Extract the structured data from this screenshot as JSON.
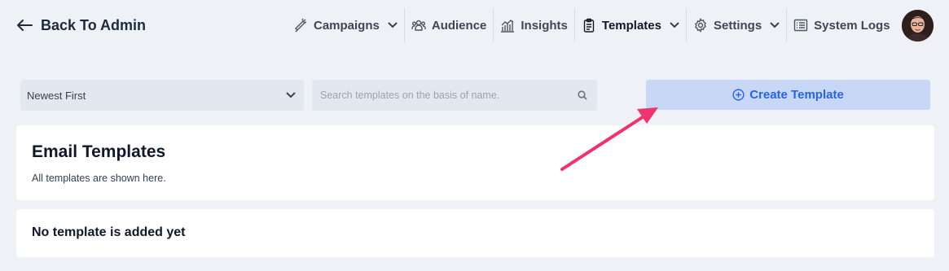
{
  "header": {
    "back_label": "Back To Admin",
    "nav": [
      {
        "label": "Campaigns",
        "icon": "megaphone-icon",
        "dropdown": true
      },
      {
        "label": "Audience",
        "icon": "users-icon",
        "dropdown": false
      },
      {
        "label": "Insights",
        "icon": "chart-icon",
        "dropdown": false
      },
      {
        "label": "Templates",
        "icon": "clipboard-icon",
        "dropdown": true,
        "active": true
      },
      {
        "label": "Settings",
        "icon": "gear-icon",
        "dropdown": true
      },
      {
        "label": "System Logs",
        "icon": "list-icon",
        "dropdown": false
      }
    ]
  },
  "toolbar": {
    "sort_value": "Newest First",
    "search_placeholder": "Search templates on the basis of name.",
    "create_label": "Create Template"
  },
  "main": {
    "title": "Email Templates",
    "subtitle": "All templates are shown here.",
    "empty_message": "No template is added yet"
  },
  "colors": {
    "background": "#eef2f7",
    "accent": "#2563eb",
    "button_bg": "#c7d7f5",
    "annotation_arrow": "#f0346b"
  }
}
